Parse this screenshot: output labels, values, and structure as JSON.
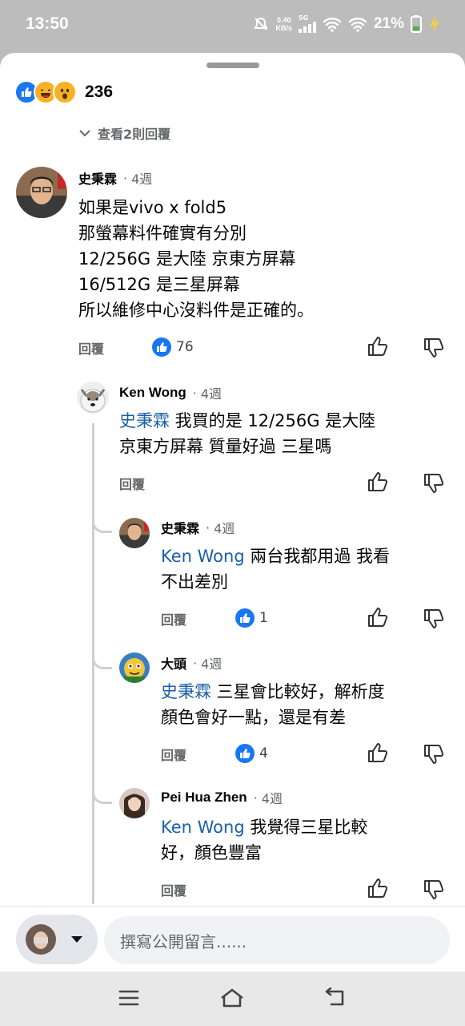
{
  "status_bar": {
    "time": "13:50",
    "net_speed": "0.40",
    "net_unit": "KB/s",
    "net_type": "5G",
    "battery": "21%"
  },
  "reactions": {
    "count": "236"
  },
  "view_replies": "查看2則回覆",
  "comments": [
    {
      "author": "史秉霖",
      "time": "4週",
      "lines": [
        "如果是vivo x fold5",
        "那螢幕料件確實有分別",
        "12/256G 是大陸 京東方屏幕",
        "16/512G 是三星屏幕",
        "所以維修中心沒料件是正確的。"
      ],
      "reply": "回覆",
      "likes": "76"
    },
    {
      "author": "Ken Wong",
      "time": "4週",
      "mention": "史秉霖",
      "text1": " 我買的是 12/256G 是大陸",
      "text2": "京東方屏幕   質量好過 三星嗎",
      "reply": "回覆"
    },
    {
      "author": "史秉霖",
      "time": "4週",
      "mention": "Ken Wong",
      "text1": " 兩台我都用過 我看",
      "text2": "不出差別",
      "reply": "回覆",
      "likes": "1"
    },
    {
      "author": "大頭",
      "time": "4週",
      "mention": "史秉霖",
      "text1": " 三星會比較好，解析度",
      "text2": "顏色會好一點，還是有差",
      "reply": "回覆",
      "likes": "4"
    },
    {
      "author": "Pei Hua Zhen",
      "time": "4週",
      "mention": "Ken Wong",
      "text1": " 我覺得三星比較",
      "text2": "好，顏色豐富",
      "reply": "回覆"
    }
  ],
  "composer": {
    "placeholder": "撰寫公開留言......"
  }
}
